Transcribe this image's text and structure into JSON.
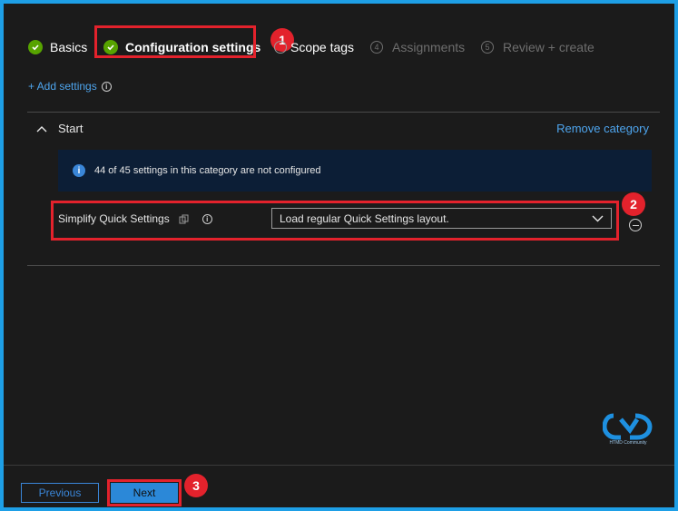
{
  "wizard": {
    "steps": [
      {
        "label": "Basics",
        "state": "complete"
      },
      {
        "label": "Configuration settings",
        "state": "current"
      },
      {
        "label": "Scope tags",
        "state": "next"
      },
      {
        "label": "Assignments",
        "number": "4",
        "state": "disabled"
      },
      {
        "label": "Review + create",
        "number": "5",
        "state": "disabled"
      }
    ]
  },
  "actions": {
    "add_settings": "+ Add settings"
  },
  "category": {
    "name": "Start",
    "remove_label": "Remove category",
    "info_message": "44 of 45 settings in this category are not configured"
  },
  "setting": {
    "label": "Simplify Quick Settings",
    "value": "Load regular Quick Settings layout."
  },
  "annotations": {
    "badge_1": "1",
    "badge_2": "2",
    "badge_3": "3"
  },
  "logo": {
    "text": "HTMD Community"
  },
  "footer": {
    "previous_label": "Previous",
    "next_label": "Next"
  },
  "colors": {
    "accent": "#2b88d8",
    "link": "#4ea5ee",
    "success": "#57a300",
    "highlight": "#e3222c",
    "frame": "#1e9fe6"
  }
}
